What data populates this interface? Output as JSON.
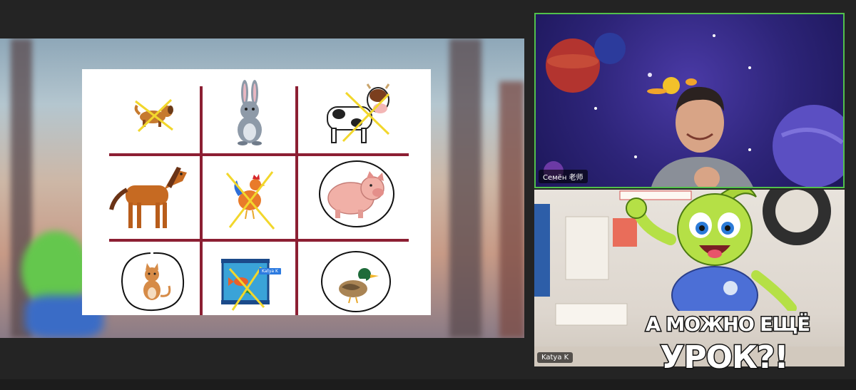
{
  "participants": [
    {
      "name": "Семён 老师",
      "active_speaker": true
    },
    {
      "name": "Katya K",
      "active_speaker": false
    }
  ],
  "caption": {
    "line1": "А МОЖНО ЕЩЁ",
    "line2": "УРОК?!"
  },
  "worksheet": {
    "cells": [
      {
        "animal": "dog",
        "mark": "cross"
      },
      {
        "animal": "rabbit",
        "mark": "none"
      },
      {
        "animal": "cow",
        "mark": "cross"
      },
      {
        "animal": "horse",
        "mark": "none"
      },
      {
        "animal": "rooster",
        "mark": "cross"
      },
      {
        "animal": "pig",
        "mark": "circle"
      },
      {
        "animal": "cat",
        "mark": "circle"
      },
      {
        "animal": "fish tank",
        "mark": "cross"
      },
      {
        "animal": "duck",
        "mark": "circle"
      }
    ],
    "cursor_label": "Katya K"
  },
  "colors": {
    "active_border": "#52c14b",
    "grid": "#8c1f33",
    "cross": "#f2d72c",
    "name_tag": "#2d7be0"
  }
}
